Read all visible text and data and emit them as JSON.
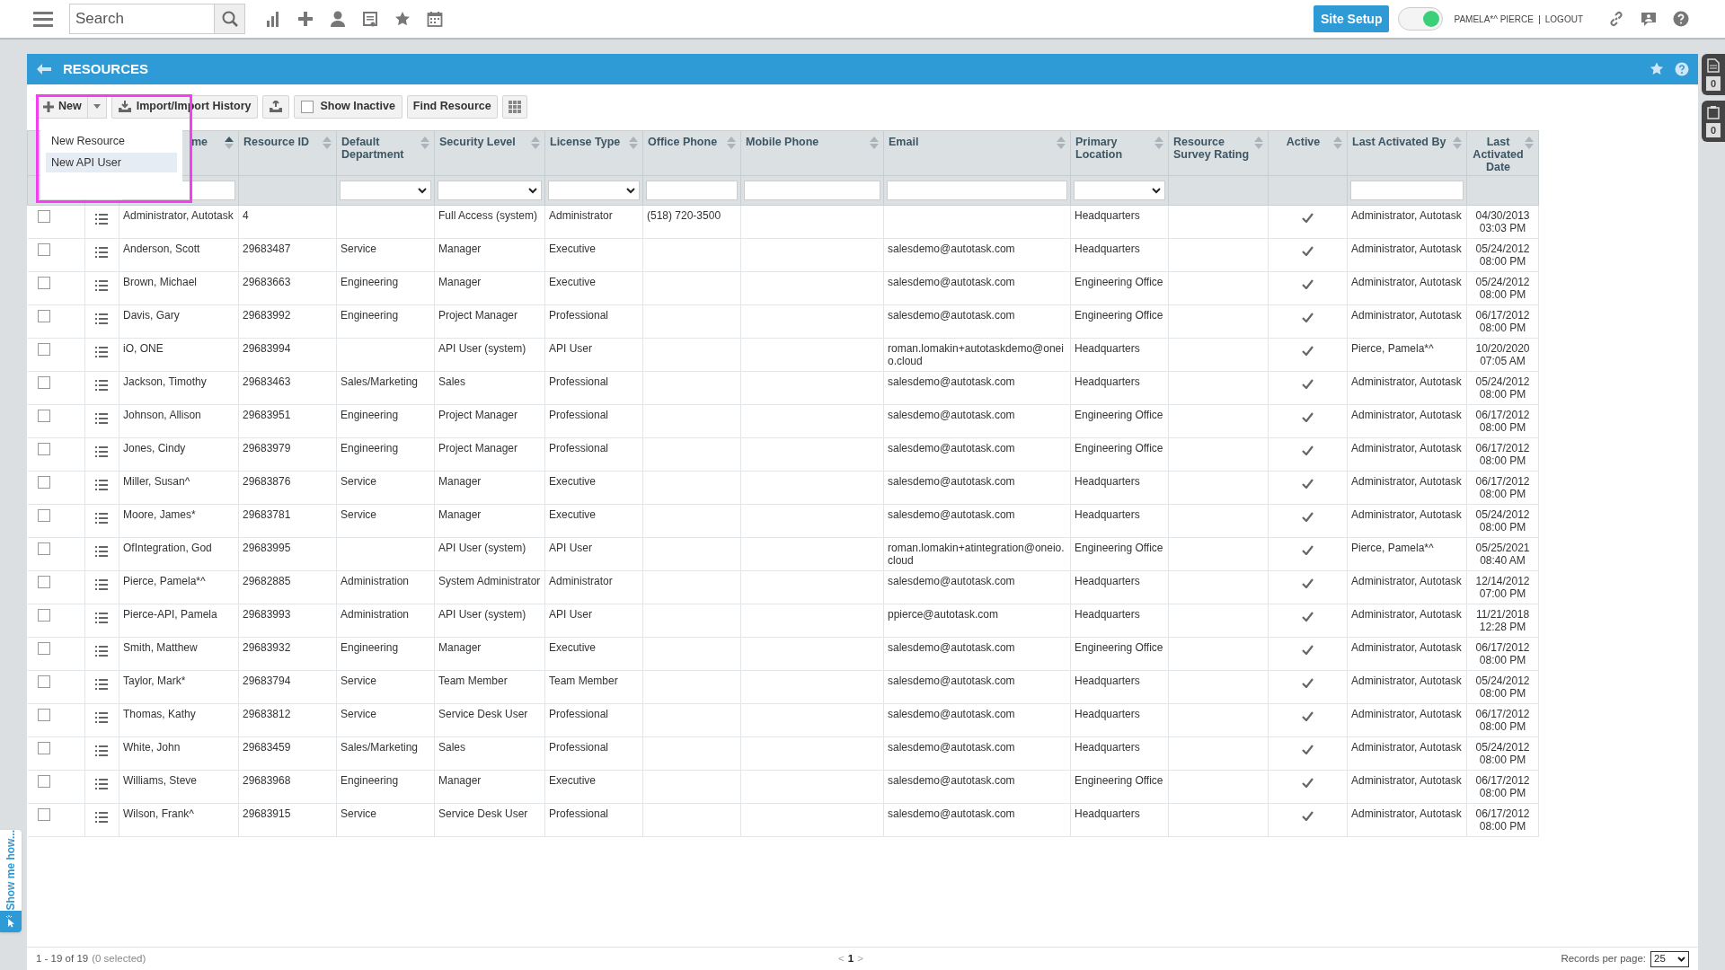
{
  "top_bar": {
    "search": {
      "placeholder": "Search"
    },
    "site_setup": "Site Setup",
    "toggle": {
      "on": true
    },
    "user": "PAMELA*^ PIERCE",
    "separator": "|",
    "logout": "LOGOUT"
  },
  "panel": {
    "title": "RESOURCES"
  },
  "toolbar": {
    "new": "New",
    "import": "Import/Import History",
    "show_inactive": {
      "label": "Show Inactive",
      "checked": false
    },
    "find": "Find Resource"
  },
  "new_menu": [
    {
      "label": "New Resource",
      "selected": false
    },
    {
      "label": "New API User",
      "selected": true
    }
  ],
  "columns": [
    {
      "label": "me",
      "sorted": true,
      "kind": "text"
    },
    {
      "label": "Resource ID",
      "sorted": false,
      "kind": "plain"
    },
    {
      "label": "Default Department",
      "sorted": false,
      "kind": "select"
    },
    {
      "label": "Security Level",
      "sorted": false,
      "kind": "select"
    },
    {
      "label": "License Type",
      "sorted": false,
      "kind": "select"
    },
    {
      "label": "Office Phone",
      "sorted": false,
      "kind": "text"
    },
    {
      "label": "Mobile Phone",
      "sorted": false,
      "kind": "text"
    },
    {
      "label": "Email",
      "sorted": false,
      "kind": "text"
    },
    {
      "label": "Primary Location",
      "sorted": false,
      "kind": "select"
    },
    {
      "label": "Resource Survey Rating",
      "sorted": false,
      "kind": "plain"
    },
    {
      "label": "Active",
      "sorted": false,
      "kind": "plain"
    },
    {
      "label": "Last Activated By",
      "sorted": false,
      "kind": "text"
    },
    {
      "label": "Last Activated Date",
      "sorted": false,
      "kind": "plain"
    }
  ],
  "rows": [
    {
      "checked": false,
      "name": "Administrator, Autotask",
      "resource_id": "4",
      "security_level": "Full Access (system)",
      "license_type": "Administrator",
      "office_phone": "(518) 720-3500",
      "primary_location": "Headquarters",
      "active": true,
      "last_activated_by": "Administrator, Autotask",
      "date": "04/30/2013",
      "time": "03:03 PM"
    },
    {
      "checked": false,
      "name": "Anderson, Scott",
      "resource_id": "29683487",
      "department": "Service",
      "security_level": "Manager",
      "license_type": "Executive",
      "email": "salesdemo@autotask.com",
      "primary_location": "Headquarters",
      "active": true,
      "last_activated_by": "Administrator, Autotask",
      "date": "05/24/2012",
      "time": "08:00 PM"
    },
    {
      "checked": false,
      "name": "Brown, Michael",
      "resource_id": "29683663",
      "department": "Engineering",
      "security_level": "Manager",
      "license_type": "Executive",
      "email": "salesdemo@autotask.com",
      "primary_location": "Engineering Office",
      "active": true,
      "last_activated_by": "Administrator, Autotask",
      "date": "05/24/2012",
      "time": "08:00 PM"
    },
    {
      "checked": false,
      "name": "Davis, Gary",
      "resource_id": "29683992",
      "department": "Engineering",
      "security_level": "Project Manager",
      "license_type": "Professional",
      "email": "salesdemo@autotask.com",
      "primary_location": "Engineering Office",
      "active": true,
      "last_activated_by": "Administrator, Autotask",
      "date": "06/17/2012",
      "time": "08:00 PM"
    },
    {
      "checked": false,
      "name": "iO, ONE",
      "resource_id": "29683994",
      "security_level": "API User (system)",
      "license_type": "API User",
      "email": "roman.lomakin+autotaskdemo@oneio.cloud",
      "primary_location": "Headquarters",
      "active": true,
      "last_activated_by": "Pierce, Pamela*^",
      "date": "10/20/2020",
      "time": "07:05 AM"
    },
    {
      "checked": false,
      "name": "Jackson, Timothy",
      "resource_id": "29683463",
      "department": "Sales/Marketing",
      "security_level": "Sales",
      "license_type": "Professional",
      "email": "salesdemo@autotask.com",
      "primary_location": "Headquarters",
      "active": true,
      "last_activated_by": "Administrator, Autotask",
      "date": "05/24/2012",
      "time": "08:00 PM"
    },
    {
      "checked": false,
      "name": "Johnson, Allison",
      "resource_id": "29683951",
      "department": "Engineering",
      "security_level": "Project Manager",
      "license_type": "Professional",
      "email": "salesdemo@autotask.com",
      "primary_location": "Engineering Office",
      "active": true,
      "last_activated_by": "Administrator, Autotask",
      "date": "06/17/2012",
      "time": "08:00 PM"
    },
    {
      "checked": false,
      "name": "Jones, Cindy",
      "resource_id": "29683979",
      "department": "Engineering",
      "security_level": "Project Manager",
      "license_type": "Professional",
      "email": "salesdemo@autotask.com",
      "primary_location": "Engineering Office",
      "active": true,
      "last_activated_by": "Administrator, Autotask",
      "date": "06/17/2012",
      "time": "08:00 PM"
    },
    {
      "checked": false,
      "name": "Miller, Susan^",
      "resource_id": "29683876",
      "department": "Service",
      "security_level": "Manager",
      "license_type": "Executive",
      "email": "salesdemo@autotask.com",
      "primary_location": "Headquarters",
      "active": true,
      "last_activated_by": "Administrator, Autotask",
      "date": "06/17/2012",
      "time": "08:00 PM"
    },
    {
      "checked": false,
      "name": "Moore, James*",
      "resource_id": "29683781",
      "department": "Service",
      "security_level": "Manager",
      "license_type": "Executive",
      "email": "salesdemo@autotask.com",
      "primary_location": "Headquarters",
      "active": true,
      "last_activated_by": "Administrator, Autotask",
      "date": "05/24/2012",
      "time": "08:00 PM"
    },
    {
      "checked": false,
      "name": "OfIntegration, God",
      "resource_id": "29683995",
      "security_level": "API User (system)",
      "license_type": "API User",
      "email": "roman.lomakin+atintegration@oneio.cloud",
      "primary_location": "Engineering Office",
      "active": true,
      "last_activated_by": "Pierce, Pamela*^",
      "date": "05/25/2021",
      "time": "08:40 AM"
    },
    {
      "checked": false,
      "name": "Pierce, Pamela*^",
      "resource_id": "29682885",
      "department": "Administration",
      "security_level": "System Administrator",
      "license_type": "Administrator",
      "email": "salesdemo@autotask.com",
      "primary_location": "Headquarters",
      "active": true,
      "last_activated_by": "Administrator, Autotask",
      "date": "12/14/2012",
      "time": "07:00 PM"
    },
    {
      "checked": false,
      "name": "Pierce-API, Pamela",
      "resource_id": "29683993",
      "department": "Administration",
      "security_level": "API User (system)",
      "license_type": "API User",
      "email": "ppierce@autotask.com",
      "primary_location": "Headquarters",
      "active": true,
      "last_activated_by": "Administrator, Autotask",
      "date": "11/21/2018",
      "time": "12:28 PM"
    },
    {
      "checked": false,
      "name": "Smith, Matthew",
      "resource_id": "29683932",
      "department": "Engineering",
      "security_level": "Manager",
      "license_type": "Executive",
      "email": "salesdemo@autotask.com",
      "primary_location": "Engineering Office",
      "active": true,
      "last_activated_by": "Administrator, Autotask",
      "date": "06/17/2012",
      "time": "08:00 PM"
    },
    {
      "checked": false,
      "name": "Taylor, Mark*",
      "resource_id": "29683794",
      "department": "Service",
      "security_level": "Team Member",
      "license_type": "Team Member",
      "email": "salesdemo@autotask.com",
      "primary_location": "Headquarters",
      "active": true,
      "last_activated_by": "Administrator, Autotask",
      "date": "05/24/2012",
      "time": "08:00 PM"
    },
    {
      "checked": false,
      "name": "Thomas, Kathy",
      "resource_id": "29683812",
      "department": "Service",
      "security_level": "Service Desk User",
      "license_type": "Professional",
      "email": "salesdemo@autotask.com",
      "primary_location": "Headquarters",
      "active": true,
      "last_activated_by": "Administrator, Autotask",
      "date": "06/17/2012",
      "time": "08:00 PM"
    },
    {
      "checked": false,
      "name": "White, John",
      "resource_id": "29683459",
      "department": "Sales/Marketing",
      "security_level": "Sales",
      "license_type": "Professional",
      "email": "salesdemo@autotask.com",
      "primary_location": "Headquarters",
      "active": true,
      "last_activated_by": "Administrator, Autotask",
      "date": "05/24/2012",
      "time": "08:00 PM"
    },
    {
      "checked": false,
      "name": "Williams, Steve",
      "resource_id": "29683968",
      "department": "Engineering",
      "security_level": "Manager",
      "license_type": "Executive",
      "email": "salesdemo@autotask.com",
      "primary_location": "Engineering Office",
      "active": true,
      "last_activated_by": "Administrator, Autotask",
      "date": "06/17/2012",
      "time": "08:00 PM"
    },
    {
      "checked": false,
      "name": "Wilson, Frank^",
      "resource_id": "29683915",
      "department": "Service",
      "security_level": "Service Desk User",
      "license_type": "Professional",
      "email": "salesdemo@autotask.com",
      "primary_location": "Headquarters",
      "active": true,
      "last_activated_by": "Administrator, Autotask",
      "date": "06/17/2012",
      "time": "08:00 PM"
    }
  ],
  "footer": {
    "range": "1 - 19 of 19",
    "selected": "(0 selected)",
    "prev": "<",
    "page": "1",
    "next": ">",
    "records_label": "Records per page:",
    "records_value": "25"
  },
  "show_me_how": "Show me how...",
  "side_widgets": [
    {
      "count": "0"
    },
    {
      "count": "0"
    }
  ]
}
